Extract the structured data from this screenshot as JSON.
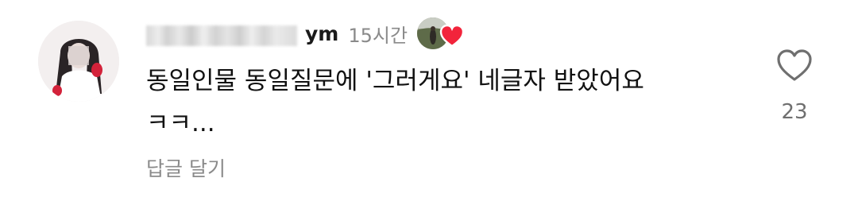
{
  "comment": {
    "username_visible": "ym",
    "timestamp": "15시간",
    "text": "동일인물 동일질문에 '그러게요' 네글자 받았어요\nㅋㅋ...",
    "reply_label": "답글 달기",
    "like_count": "23"
  },
  "icons": {
    "like": "heart-outline-icon",
    "creator_liked": "heart-filled-icon"
  },
  "colors": {
    "heart_red": "#f2243b",
    "muted_gray": "#8a8a8a"
  }
}
